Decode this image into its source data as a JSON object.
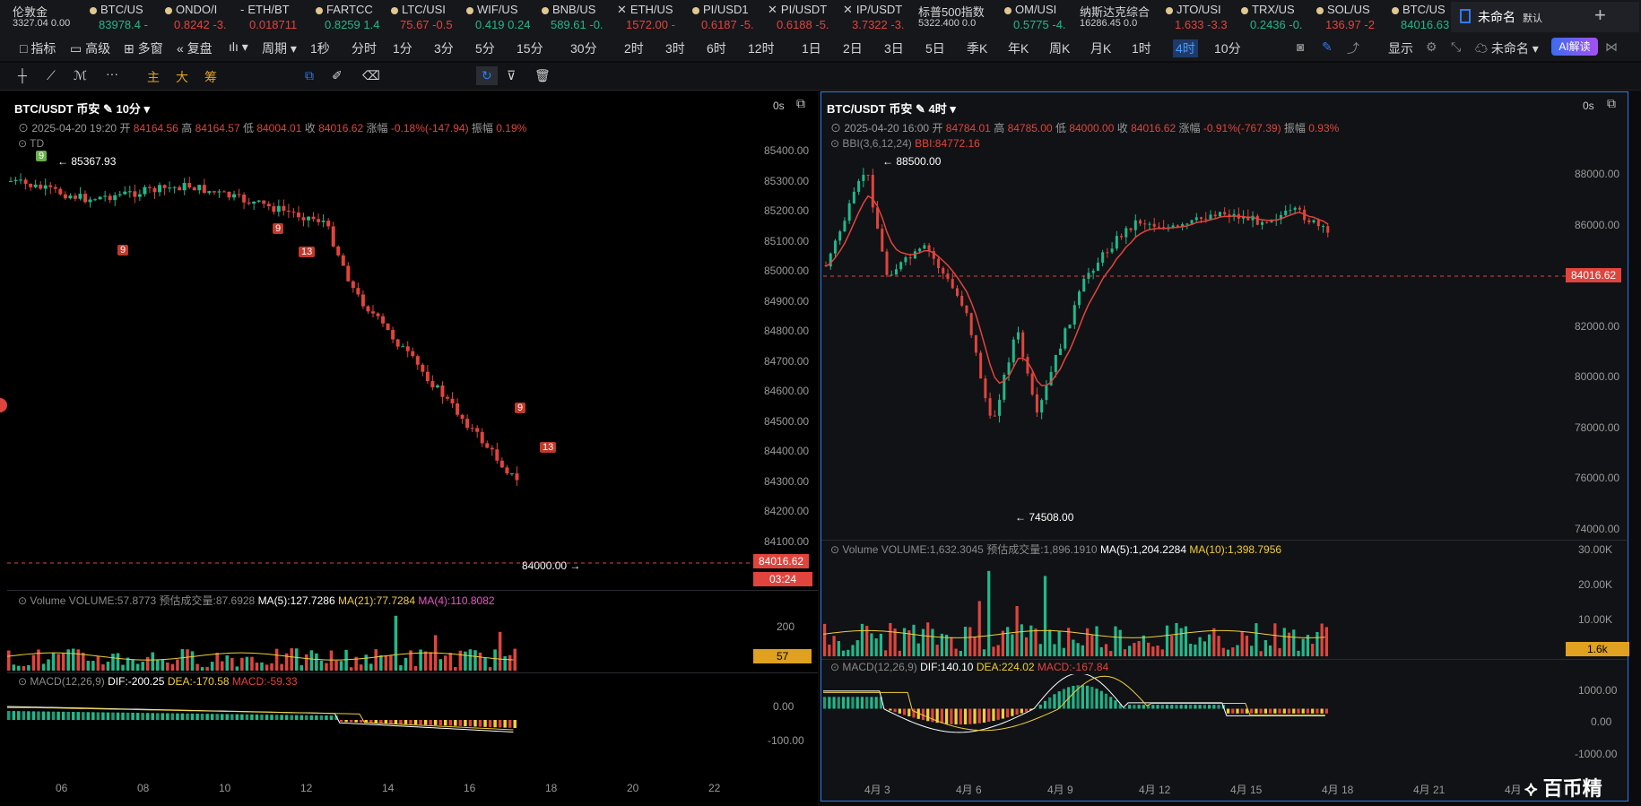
{
  "tickers": [
    {
      "name": "伦敦金",
      "price": "3327.04 0.00",
      "up": true,
      "icon": "none"
    },
    {
      "name": "BTC/US",
      "price": "83978.4 -",
      "up": true,
      "icon": "dot"
    },
    {
      "name": "ONDO/I",
      "price": "0.8242 -3.",
      "up": false,
      "icon": "dot"
    },
    {
      "name": "ETH/BT",
      "price": "0.018711",
      "up": false,
      "icon": "dash"
    },
    {
      "name": "FARTCC",
      "price": "0.8259 1.4",
      "up": true,
      "icon": "dot"
    },
    {
      "name": "LTC/USI",
      "price": "75.67 -0.5",
      "up": false,
      "icon": "dot"
    },
    {
      "name": "WIF/US",
      "price": "0.419 0.24",
      "up": true,
      "icon": "dot"
    },
    {
      "name": "BNB/US",
      "price": "589.61 -0.",
      "up": true,
      "icon": "dot"
    },
    {
      "name": "ETH/US",
      "price": "1572.00 -",
      "up": false,
      "icon": "close"
    },
    {
      "name": "PI/USD1",
      "price": "0.6187 -5.",
      "up": false,
      "icon": "dot"
    },
    {
      "name": "PI/USDT",
      "price": "0.6188 -5.",
      "up": false,
      "icon": "close"
    },
    {
      "name": "IP/USDT",
      "price": "3.7322 -3.",
      "up": false,
      "icon": "close"
    },
    {
      "name": "标普500指数",
      "price": "5322.400 0.0",
      "up": true,
      "icon": "none"
    },
    {
      "name": "OM/USI",
      "price": "0.5775 -4.",
      "up": true,
      "icon": "dot"
    },
    {
      "name": "纳斯达克综合",
      "price": "16286.45 0.0",
      "up": true,
      "icon": "none"
    },
    {
      "name": "JTO/USI",
      "price": "1.633 -3.3",
      "up": false,
      "icon": "dot"
    },
    {
      "name": "TRX/US",
      "price": "0.2436 -0.",
      "up": true,
      "icon": "dot"
    },
    {
      "name": "SOL/US",
      "price": "136.97 -2",
      "up": false,
      "icon": "dot"
    },
    {
      "name": "BTC/US",
      "price": "84016.63 -",
      "up": true,
      "icon": "dot"
    }
  ],
  "workspace": {
    "name": "未命名",
    "tag": "默认",
    "add": "+"
  },
  "toolbar": {
    "items": [
      "指标",
      "高级",
      "多窗",
      "复盘",
      "周期"
    ],
    "periods": [
      "1秒",
      "分时",
      "1分",
      "3分",
      "5分",
      "15分",
      "30分",
      "2时",
      "3时",
      "6时",
      "12时",
      "1日",
      "2日",
      "3日",
      "5日",
      "季K",
      "年K",
      "周K",
      "月K",
      "1时",
      "4时",
      "10分"
    ],
    "active_period": "4时",
    "right": {
      "display": "显示",
      "layout": "未命名",
      "ai": "AI解读"
    },
    "draw_tools": [
      "主",
      "大",
      "筹"
    ]
  },
  "left": {
    "symbol": "BTC/USDT 币安",
    "period": "10分",
    "timer": "0s",
    "ohlc": {
      "date": "2025-04-20 19:20",
      "open_l": "开",
      "open": "84164.56",
      "high_l": "高",
      "high": "84164.57",
      "low_l": "低",
      "low": "84004.01",
      "close_l": "收",
      "close": "84016.62",
      "chg_l": "涨幅",
      "chg": "-0.18%(-147.94)",
      "amp_l": "振幅",
      "amp": "0.19%"
    },
    "td_label": "TD",
    "high_mark": "85367.93",
    "low_mark": "84000.00",
    "price_tag": "84016.62",
    "countdown": "03:24",
    "y_ticks": [
      "85400.00",
      "85300.00",
      "85200.00",
      "85100.00",
      "85000.00",
      "84900.00",
      "84800.00",
      "84700.00",
      "84600.00",
      "84500.00",
      "84400.00",
      "84300.00",
      "84200.00",
      "84100.00"
    ],
    "x_ticks": [
      "06",
      "08",
      "10",
      "12",
      "14",
      "16",
      "18",
      "20",
      "22"
    ],
    "td_badges": [
      "9",
      "9",
      "9",
      "13",
      "9",
      "13"
    ],
    "volume": {
      "title": "Volume",
      "vol": "VOLUME:57.8773",
      "pred": "预估成交量:87.6928",
      "ma5": "MA(5):127.7286",
      "ma21": "MA(21):77.7284",
      "ma4": "MA(4):110.8082",
      "tick": "200",
      "tag": "57"
    },
    "macd": {
      "title": "MACD(12,26,9)",
      "dif": "DIF:-200.25",
      "dea": "DEA:-170.58",
      "macd": "MACD:-59.33",
      "ticks": [
        "0.00",
        "-100.00"
      ]
    }
  },
  "right": {
    "symbol": "BTC/USDT 币安",
    "period": "4时",
    "timer": "0s",
    "ohlc": {
      "date": "2025-04-20 16:00",
      "open_l": "开",
      "open": "84784.01",
      "high_l": "高",
      "high": "84785.00",
      "low_l": "低",
      "low": "84000.00",
      "close_l": "收",
      "close": "84016.62",
      "chg_l": "涨幅",
      "chg": "-0.91%(-767.39)",
      "amp_l": "振幅",
      "amp": "0.93%"
    },
    "bbi": "BBI(3,6,12,24)",
    "bbi_val": "BBI:84772.16",
    "high_mark": "88500.00",
    "low_mark": "74508.00",
    "price_tag": "84016.62",
    "y_ticks": [
      "88000.00",
      "86000.00",
      "84000.00",
      "82000.00",
      "80000.00",
      "78000.00",
      "76000.00",
      "74000.00"
    ],
    "x_ticks": [
      "4月 3",
      "4月 6",
      "4月 9",
      "4月 12",
      "4月 15",
      "4月 18",
      "4月 21",
      "4月"
    ],
    "volume": {
      "title": "Volume",
      "vol": "VOLUME:1,632.3045",
      "pred": "预估成交量:1,896.1910",
      "ma5": "MA(5):1,204.2284",
      "ma10": "MA(10):1,398.7956",
      "ticks": [
        "30.00K",
        "20.00K",
        "10.00K"
      ],
      "tag": "1.6k"
    },
    "macd": {
      "title": "MACD(12,26,9)",
      "dif": "DIF:140.10",
      "dea": "DEA:224.02",
      "macd": "MACD:-167.84",
      "ticks": [
        "1000.00",
        "0.00",
        "-1000.00"
      ]
    }
  },
  "brand": "百币精",
  "colors": {
    "up": "#21b88a",
    "down": "#e0443d",
    "bg": "#000000",
    "accent": "#2e7bf0",
    "ma_yellow": "#f0cf3a",
    "ma_pink": "#e55ac9"
  }
}
